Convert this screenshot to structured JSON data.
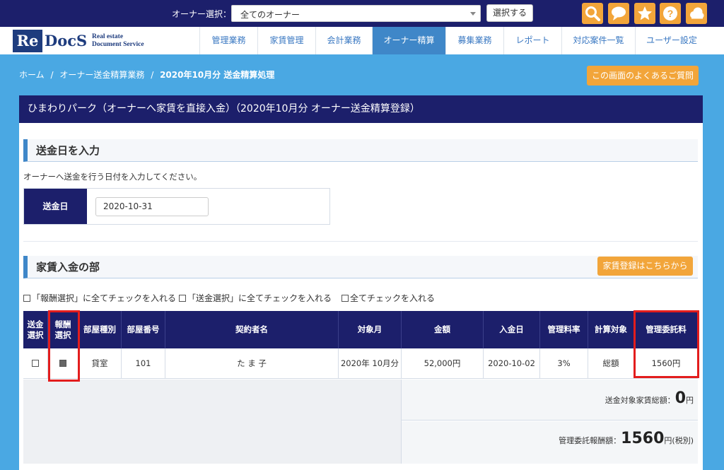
{
  "topbar": {
    "owner_label": "オーナー選択：",
    "owner_select_value": "全てのオーナー",
    "select_button": "選択する",
    "icons": [
      "search-icon",
      "chat-icon",
      "star-icon",
      "help-icon",
      "cloud-icon"
    ],
    "accent": "#f2a53a",
    "bar_color": "#1c1f6b"
  },
  "logo": {
    "re": "Re",
    "docs": "DocS",
    "sub_line1": "Real estate",
    "sub_line2": "Document Service"
  },
  "nav": {
    "items": [
      {
        "label": "管理業務"
      },
      {
        "label": "家賃管理"
      },
      {
        "label": "会計業務"
      },
      {
        "label": "オーナー精算",
        "active": true
      },
      {
        "label": "募集業務"
      },
      {
        "label": "レポート"
      },
      {
        "label": "対応案件一覧"
      },
      {
        "label": "ユーザー設定"
      }
    ]
  },
  "breadcrumb": {
    "home": "ホーム",
    "sep": "/",
    "level1": "オーナー送金精算業務",
    "current": "2020年10月分 送金精算処理"
  },
  "faq_button": "この画面のよくあるご質問",
  "panel": {
    "title": "ひまわりパーク（オーナーへ家賃を直接入金）（2020年10月分 オーナー送金精算登録）"
  },
  "remit_section": {
    "title": "送金日を入力",
    "description": "オーナーへ送金を行う日付を入力してください。",
    "date_label": "送金日",
    "date_value": "2020-10-31"
  },
  "rent_section": {
    "title": "家賃入金の部",
    "register_button": "家賃登録はこちらから",
    "check_options": [
      "「報酬選択」に全てチェックを入れる",
      "「送金選択」に全てチェックを入れる",
      "全てチェックを入れる"
    ],
    "headers": {
      "remit_select": "送金\n選択",
      "fee_select": "報酬\n選択",
      "room_type": "部屋種別",
      "room_no": "部屋番号",
      "contractor": "契約者名",
      "target_month": "対象月",
      "amount": "金額",
      "paid_date": "入金日",
      "mgmt_rate": "管理料率",
      "calc_target": "計算対象",
      "mgmt_fee": "管理委託料"
    },
    "rows": [
      {
        "remit_checked": false,
        "fee_checked": true,
        "room_type": "貸室",
        "room_no": "101",
        "contractor": "た ま 子",
        "target_month": "2020年 10月分",
        "amount": "52,000円",
        "paid_date": "2020-10-02",
        "mgmt_rate": "3%",
        "calc_target": "総額",
        "mgmt_fee": "1560円"
      }
    ],
    "totals": {
      "remit_total_label": "送金対象家賃総額：",
      "remit_total_value": "0",
      "remit_total_unit": "円",
      "fee_total_label": "管理委託報酬額：",
      "fee_total_value": "1560",
      "fee_total_unit": "円(税別)"
    }
  },
  "highlight_color": "#e31d1d"
}
